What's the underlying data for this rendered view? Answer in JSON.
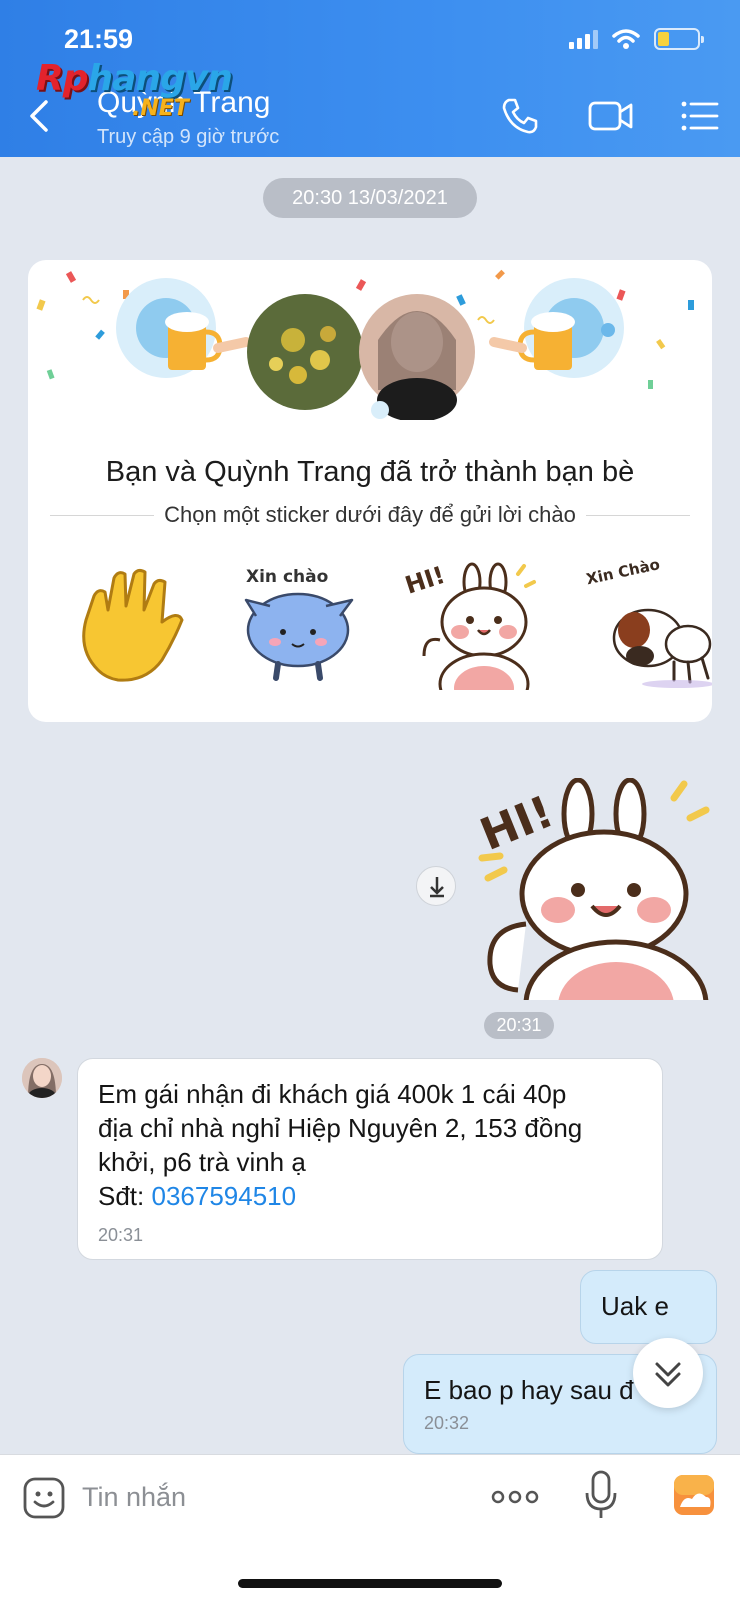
{
  "status_bar": {
    "time": "21:59"
  },
  "watermark": {
    "part_a": "Rp",
    "part_b": "hangvn",
    "suffix": ".NET"
  },
  "header": {
    "contact_name": "Quỳnh Trang",
    "last_seen": "Truy cập 9 giờ trước",
    "icons": [
      "back-icon",
      "phone-icon",
      "video-call-icon",
      "menu-list-icon"
    ]
  },
  "conversation": {
    "date_divider": "20:30 13/03/2021",
    "friend_card": {
      "title": "Bạn và Quỳnh Trang đã trở thành bạn bè",
      "subtitle": "Chọn một sticker dưới đây để gửi lời chào",
      "stickers": [
        {
          "name": "waving-hand"
        },
        {
          "name": "xin-chao-cat",
          "caption": "Xin chào"
        },
        {
          "name": "hi-bunny",
          "caption": "HI!"
        },
        {
          "name": "xin-chao-dog",
          "caption": "Xin Chào"
        }
      ]
    },
    "sent_sticker": {
      "caption": "HI!"
    },
    "sticker_time": "20:31",
    "messages": [
      {
        "direction": "incoming",
        "lines": [
          "Em gái nhận đi khách giá 400k 1 cái 40p",
          "địa chỉ nhà nghỉ Hiệp Nguyên 2, 153 đồng",
          "khởi, p6 trà vinh ạ"
        ],
        "phone_label": "Sđt: ",
        "phone_number": "0367594510",
        "time": "20:31"
      },
      {
        "direction": "outgoing",
        "text": "Uak e"
      },
      {
        "direction": "outgoing",
        "text": "E bao p hay sau đ",
        "time": "20:32"
      }
    ]
  },
  "composer": {
    "placeholder": "Tin nhắn"
  },
  "colors": {
    "header": "#3d8ff0",
    "link": "#1f86e6",
    "outgoing_bubble": "#d4ebfb",
    "background": "#e2e7ef"
  }
}
